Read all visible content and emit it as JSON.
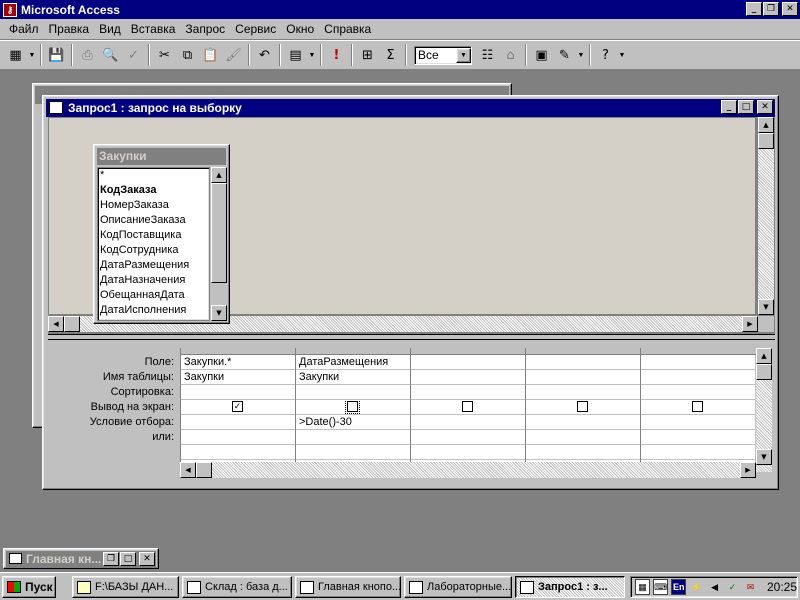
{
  "app": {
    "title": "Microsoft Access"
  },
  "menu": {
    "items": [
      "Файл",
      "Правка",
      "Вид",
      "Вставка",
      "Запрос",
      "Сервис",
      "Окно",
      "Справка"
    ]
  },
  "toolbar": {
    "top_values": "Все"
  },
  "query_window": {
    "title": "Запрос1 : запрос на выборку",
    "table": {
      "name": "Закупки",
      "fields": [
        "*",
        "КодЗаказа",
        "НомерЗаказа",
        "ОписаниеЗаказа",
        "КодПоставщика",
        "КодСотрудника",
        "ДатаРазмещения",
        "ДатаНазначения",
        "ОбещаннаяДата",
        "ДатаИсполнения"
      ],
      "bold_field": "КодЗаказа"
    },
    "grid": {
      "row_labels": [
        "Поле:",
        "Имя таблицы:",
        "Сортировка:",
        "Вывод на экран:",
        "Условие отбора:",
        "или:"
      ],
      "columns": [
        {
          "field": "Закупки.*",
          "table": "Закупки",
          "sort": "",
          "show": true,
          "criteria": "",
          "or": ""
        },
        {
          "field": "ДатаРазмещения",
          "table": "Закупки",
          "sort": "",
          "show": false,
          "criteria": ">Date()-30",
          "or": ""
        },
        {
          "field": "",
          "table": "",
          "sort": "",
          "show": false,
          "criteria": "",
          "or": ""
        },
        {
          "field": "",
          "table": "",
          "sort": "",
          "show": false,
          "criteria": "",
          "or": ""
        },
        {
          "field": "",
          "table": "",
          "sort": "",
          "show": false,
          "criteria": "",
          "or": ""
        }
      ]
    }
  },
  "minimized_window": {
    "title": "Главная кн..."
  },
  "taskbar": {
    "start": "Пуск",
    "tasks": [
      "F:\\БАЗЫ ДАН...",
      "Склад : база д...",
      "Главная кнопо...",
      "Лабораторные...",
      "Запрос1 : з..."
    ],
    "active_task_index": 4,
    "tray_lang": "En",
    "clock": "20:25"
  }
}
